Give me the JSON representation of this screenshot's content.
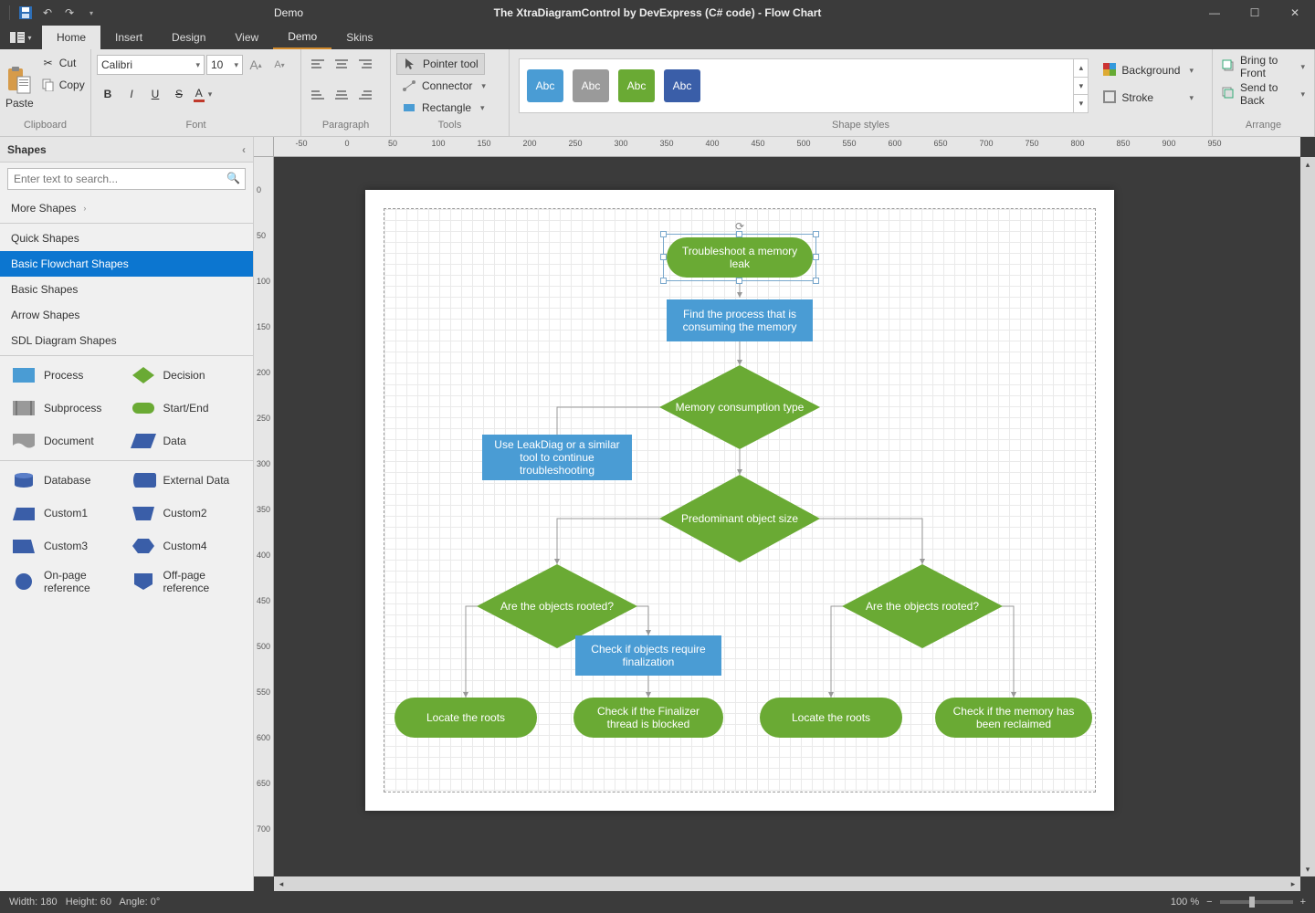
{
  "titlebar": {
    "doc_name": "Demo",
    "app_title": "The XtraDiagramControl by DevExpress (C# code) - Flow Chart"
  },
  "tabs": {
    "home": "Home",
    "insert": "Insert",
    "design": "Design",
    "view": "View",
    "demo": "Demo",
    "skins": "Skins"
  },
  "ribbon": {
    "clipboard": {
      "label": "Clipboard",
      "paste": "Paste",
      "cut": "Cut",
      "copy": "Copy"
    },
    "font": {
      "label": "Font",
      "family": "Calibri",
      "size": "10"
    },
    "paragraph": {
      "label": "Paragraph"
    },
    "tools": {
      "label": "Tools",
      "pointer": "Pointer tool",
      "connector": "Connector",
      "rectangle": "Rectangle"
    },
    "shape_styles": {
      "label": "Shape styles",
      "abc": "Abc",
      "background": "Background",
      "stroke": "Stroke"
    },
    "arrange": {
      "label": "Arrange",
      "front": "Bring to Front",
      "back": "Send to Back"
    }
  },
  "shapes_panel": {
    "title": "Shapes",
    "search_placeholder": "Enter text to search...",
    "cats": {
      "more": "More Shapes",
      "quick": "Quick Shapes",
      "basic_flow": "Basic Flowchart Shapes",
      "basic": "Basic Shapes",
      "arrow": "Arrow Shapes",
      "sdl": "SDL Diagram Shapes"
    },
    "items": {
      "process": "Process",
      "decision": "Decision",
      "subprocess": "Subprocess",
      "startend": "Start/End",
      "document": "Document",
      "data": "Data",
      "database": "Database",
      "external": "External Data",
      "custom1": "Custom1",
      "custom2": "Custom2",
      "custom3": "Custom3",
      "custom4": "Custom4",
      "onpage": "On-page reference",
      "offpage": "Off-page reference"
    }
  },
  "flow": {
    "n1": "Troubleshoot a memory leak",
    "n2": "Find the process that is consuming the memory",
    "n3": "Memory consumption type",
    "n4": "Use LeakDiag or a similar tool to continue troubleshooting",
    "n5": "Predominant object size",
    "n6": "Are the objects rooted?",
    "n7": "Are the objects rooted?",
    "n8": "Check if objects require finalization",
    "n9": "Locate the roots",
    "n10": "Check if the Finalizer thread is blocked",
    "n11": "Locate the roots",
    "n12": "Check if the memory has been reclaimed"
  },
  "status": {
    "width_label": "Width:",
    "width_val": "180",
    "height_label": "Height:",
    "height_val": "60",
    "angle_label": "Angle:",
    "angle_val": "0°",
    "zoom": "100 %"
  },
  "ruler_h": [
    "-50",
    "0",
    "50",
    "100",
    "150",
    "200",
    "250",
    "300",
    "350",
    "400",
    "450",
    "500",
    "550",
    "600",
    "650",
    "700",
    "750",
    "800",
    "850",
    "900",
    "950"
  ],
  "ruler_v": [
    "0",
    "50",
    "100",
    "150",
    "200",
    "250",
    "300",
    "350",
    "400",
    "450",
    "500",
    "550",
    "600",
    "650",
    "700"
  ]
}
